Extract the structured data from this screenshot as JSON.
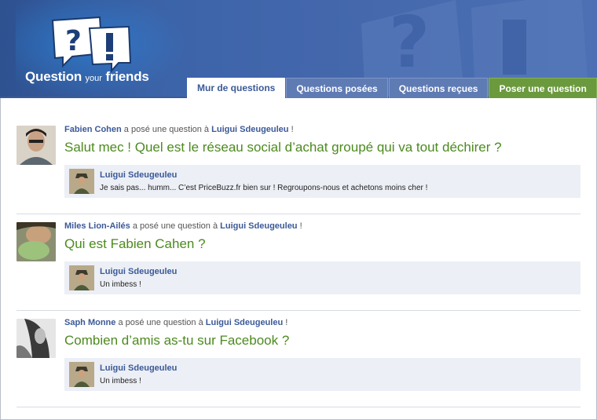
{
  "logo": {
    "line1": "Question",
    "line2": "your",
    "line3": "friends"
  },
  "tabs": [
    {
      "label": "Mur de questions",
      "state": "active"
    },
    {
      "label": "Questions posées",
      "state": "normal"
    },
    {
      "label": "Questions reçues",
      "state": "normal"
    },
    {
      "label": "Poser une question",
      "state": "green"
    }
  ],
  "posts": [
    {
      "asker": "Fabien Cohen",
      "connector": "a posé une question à",
      "target": "Luigui Sdeugeuleu",
      "exclaim": "!",
      "question": "Salut mec ! Quel est le réseau social d’achat groupé qui va tout déchirer ?",
      "answer_name": "Luigui Sdeugeuleu",
      "answer_text": "Je sais pas... humm... C’est PriceBuzz.fr bien sur ! Regroupons-nous et achetons moins cher !"
    },
    {
      "asker": "Miles Lion-Ailés",
      "connector": "a posé une question à",
      "target": "Luigui Sdeugeuleu",
      "exclaim": "!",
      "question": "Qui est Fabien Cahen ?",
      "answer_name": "Luigui Sdeugeuleu",
      "answer_text": "Un imbess !"
    },
    {
      "asker": "Saph Monne",
      "connector": "a posé une question à",
      "target": "Luigui Sdeugeuleu",
      "exclaim": "!",
      "question": "Combien d’amis as-tu sur Facebook ?",
      "answer_name": "Luigui Sdeugeuleu",
      "answer_text": "Un imbess !"
    }
  ],
  "colors": {
    "header_blue": "#3b63a8",
    "link_blue": "#3b5998",
    "question_green": "#4c8a1e",
    "tab_green": "#6b9a3e",
    "answer_bg": "#eceff5"
  }
}
